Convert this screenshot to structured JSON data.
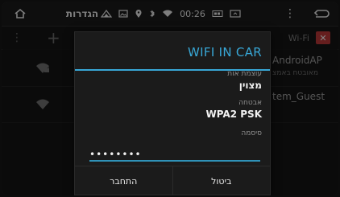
{
  "statusbar": {
    "title": "הגדרות",
    "time": "00:26",
    "icons": [
      "home-icon",
      "signal-icon",
      "picture-icon",
      "location-icon",
      "bluetooth-icon",
      "wifi-icon",
      "sd-card-icon",
      "screen-icon",
      "overflow-menu-icon",
      "back-icon"
    ]
  },
  "actionbar": {
    "title": "Wi-Fi",
    "icons": [
      "overflow-dots-icon",
      "add-icon",
      "wifi-toggle-icon"
    ]
  },
  "networks": [
    {
      "name": "AndroidAP",
      "subtitle": "מאובטח באמצ"
    },
    {
      "name": "tem_Guest",
      "subtitle": ""
    }
  ],
  "dialog": {
    "title": "WIFI IN CAR",
    "fields": [
      {
        "label": "עוצמת אות",
        "value": "מצוין"
      },
      {
        "label": "אבטחה",
        "value": "WPA2 PSK"
      },
      {
        "label": "סיסמה",
        "value": ""
      }
    ],
    "password_value": "••••••••",
    "buttons": {
      "connect": "התחבר",
      "cancel": "ביטול"
    }
  },
  "colors": {
    "accent": "#38a7d6",
    "toggle": "#b83737"
  }
}
